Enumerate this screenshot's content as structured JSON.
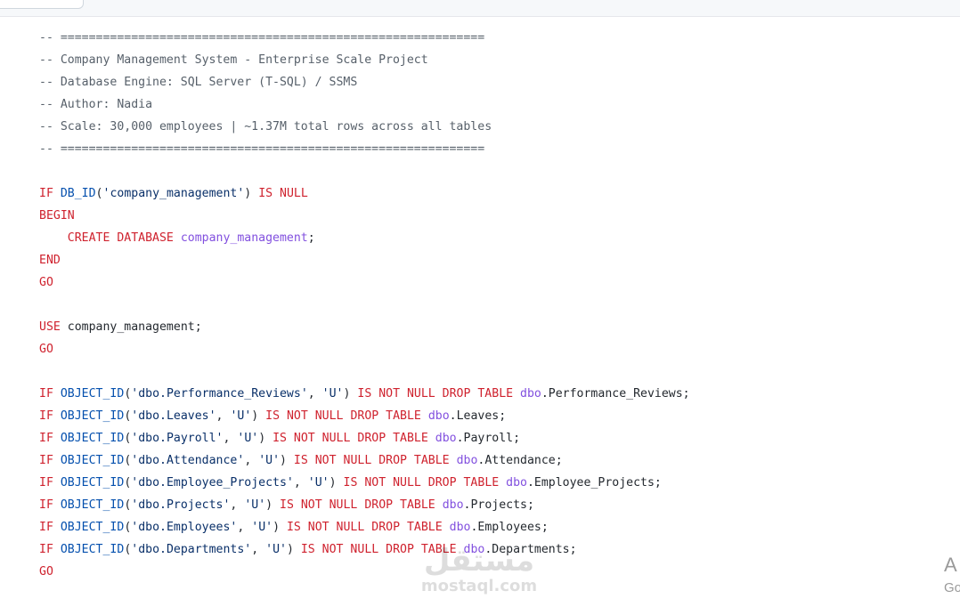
{
  "code": {
    "comment_header": {
      "rule": "-- ============================================================",
      "title": "-- Company Management System - Enterprise Scale Project",
      "engine": "-- Database Engine: SQL Server (T-SQL) / SSMS",
      "author": "-- Author: Nadia",
      "scale": "-- Scale: 30,000 employees | ~1.37M total rows across all tables"
    },
    "create_db": {
      "if": "IF",
      "db_id": "DB_ID",
      "open": "(",
      "name_str": "'company_management'",
      "close": ")",
      "is_null": "IS NULL",
      "begin": "BEGIN",
      "indent": "    ",
      "create": "CREATE DATABASE",
      "db_name": "company_management",
      "semi": ";",
      "end": "END",
      "go": "GO"
    },
    "use_stmt": {
      "use": "USE",
      "db_name": "company_management;",
      "go": "GO"
    },
    "drops": {
      "if": "IF",
      "object_id": "OBJECT_ID",
      "type_str": "'U'",
      "is_not_null": "IS NOT NULL",
      "drop_table": "DROP TABLE",
      "schema": "dbo",
      "go": "GO",
      "rows": [
        {
          "str": "'dbo.Performance_Reviews'",
          "table": ".Performance_Reviews;"
        },
        {
          "str": "'dbo.Leaves'",
          "table": ".Leaves;"
        },
        {
          "str": "'dbo.Payroll'",
          "table": ".Payroll;"
        },
        {
          "str": "'dbo.Attendance'",
          "table": ".Attendance;"
        },
        {
          "str": "'dbo.Employee_Projects'",
          "table": ".Employee_Projects;"
        },
        {
          "str": "'dbo.Projects'",
          "table": ".Projects;"
        },
        {
          "str": "'dbo.Employees'",
          "table": ".Employees;"
        },
        {
          "str": "'dbo.Departments'",
          "table": ".Departments;"
        }
      ]
    }
  },
  "watermark": {
    "arabic": "مستقل",
    "latin": "mostaql.com"
  },
  "os_overlay": {
    "line1": "A",
    "line2": "Go"
  },
  "colors": {
    "keyword": "#cf222e",
    "function": "#0550ae",
    "string": "#0a3069",
    "schema": "#8250df",
    "comment": "#57606a"
  }
}
